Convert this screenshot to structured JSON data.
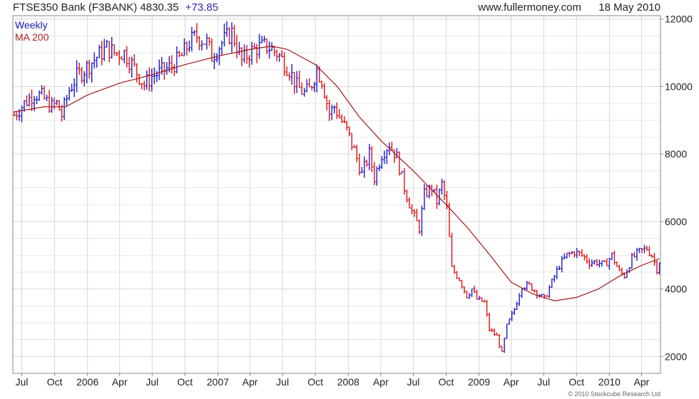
{
  "header": {
    "symbol_text": "FTSE350 Bank (F3BANK) 4830.35",
    "change": "+73.85",
    "site": "www.fullermoney.com",
    "date": "18 May 2010"
  },
  "legend": {
    "series1": "Weekly",
    "series2": "MA 200"
  },
  "copyright": "© 2010 Stockcube Research Ltd",
  "colors": {
    "up": "#1a1ad0",
    "down": "#e01010",
    "ma": "#a01818",
    "grid": "#d8d8d8",
    "frame": "#888888"
  },
  "chart_data": {
    "type": "line",
    "title": "FTSE350 Bank (F3BANK) 4830.35 +73.85",
    "xlabel": "",
    "ylabel": "",
    "ylim": [
      1500,
      12100
    ],
    "xlim": [
      "2005-06-06",
      "2010-05-24"
    ],
    "y_ticks": [
      2000,
      4000,
      6000,
      8000,
      10000,
      12000
    ],
    "x_ticks": [
      {
        "label": "Jul",
        "date": "2005-07-01"
      },
      {
        "label": "Oct",
        "date": "2005-10-01"
      },
      {
        "label": "2006",
        "date": "2006-01-01"
      },
      {
        "label": "Apr",
        "date": "2006-04-01"
      },
      {
        "label": "Jul",
        "date": "2006-07-01"
      },
      {
        "label": "Oct",
        "date": "2006-10-01"
      },
      {
        "label": "2007",
        "date": "2007-01-01"
      },
      {
        "label": "Apr",
        "date": "2007-04-01"
      },
      {
        "label": "Jul",
        "date": "2007-07-01"
      },
      {
        "label": "Oct",
        "date": "2007-10-01"
      },
      {
        "label": "2008",
        "date": "2008-01-01"
      },
      {
        "label": "Apr",
        "date": "2008-04-01"
      },
      {
        "label": "Jul",
        "date": "2008-07-01"
      },
      {
        "label": "Oct",
        "date": "2008-10-01"
      },
      {
        "label": "2009",
        "date": "2009-01-01"
      },
      {
        "label": "Apr",
        "date": "2009-04-01"
      },
      {
        "label": "Jul",
        "date": "2009-07-01"
      },
      {
        "label": "Oct",
        "date": "2009-10-01"
      },
      {
        "label": "2010",
        "date": "2010-01-01"
      },
      {
        "label": "Apr",
        "date": "2010-04-01"
      }
    ],
    "series": [
      {
        "name": "Weekly",
        "style": "bars, blue up / red down",
        "points": [
          [
            "2005-06-10",
            9150
          ],
          [
            "2005-07-08",
            9500
          ],
          [
            "2005-08-05",
            9800
          ],
          [
            "2005-08-26",
            9700
          ],
          [
            "2005-09-23",
            9400
          ],
          [
            "2005-10-07",
            9500
          ],
          [
            "2005-10-21",
            9150
          ],
          [
            "2005-11-11",
            9900
          ],
          [
            "2005-12-02",
            10300
          ],
          [
            "2005-12-23",
            10500
          ],
          [
            "2006-01-20",
            10800
          ],
          [
            "2006-02-24",
            11150
          ],
          [
            "2006-03-17",
            11000
          ],
          [
            "2006-04-14",
            11000
          ],
          [
            "2006-05-12",
            10550
          ],
          [
            "2006-06-09",
            10050
          ],
          [
            "2006-06-30",
            10300
          ],
          [
            "2006-07-28",
            10450
          ],
          [
            "2006-08-25",
            10600
          ],
          [
            "2006-09-22",
            10900
          ],
          [
            "2006-10-13",
            11300
          ],
          [
            "2006-11-03",
            11500
          ],
          [
            "2006-12-01",
            11300
          ],
          [
            "2006-12-15",
            10900
          ],
          [
            "2007-01-12",
            11300
          ],
          [
            "2007-02-09",
            11600
          ],
          [
            "2007-02-23",
            11200
          ],
          [
            "2007-03-09",
            10750
          ],
          [
            "2007-03-30",
            11000
          ],
          [
            "2007-04-20",
            11150
          ],
          [
            "2007-05-18",
            11200
          ],
          [
            "2007-06-15",
            11000
          ],
          [
            "2007-06-29",
            10800
          ],
          [
            "2007-07-20",
            10500
          ],
          [
            "2007-08-10",
            10000
          ],
          [
            "2007-08-31",
            9800
          ],
          [
            "2007-09-14",
            9900
          ],
          [
            "2007-10-05",
            10500
          ],
          [
            "2007-10-19",
            10200
          ],
          [
            "2007-11-09",
            9200
          ],
          [
            "2007-11-23",
            9400
          ],
          [
            "2007-12-07",
            9100
          ],
          [
            "2007-12-28",
            8700
          ],
          [
            "2008-01-18",
            8100
          ],
          [
            "2008-02-08",
            7400
          ],
          [
            "2008-02-29",
            8000
          ],
          [
            "2008-03-14",
            7300
          ],
          [
            "2008-04-04",
            8000
          ],
          [
            "2008-04-25",
            8300
          ],
          [
            "2008-05-16",
            7900
          ],
          [
            "2008-06-06",
            7000
          ],
          [
            "2008-06-27",
            6300
          ],
          [
            "2008-07-18",
            5800
          ],
          [
            "2008-08-01",
            6800
          ],
          [
            "2008-08-22",
            7000
          ],
          [
            "2008-09-05",
            6600
          ],
          [
            "2008-09-19",
            7100
          ],
          [
            "2008-10-03",
            6400
          ],
          [
            "2008-10-17",
            4600
          ],
          [
            "2008-11-07",
            4300
          ],
          [
            "2008-11-28",
            3800
          ],
          [
            "2008-12-12",
            4000
          ],
          [
            "2008-12-26",
            3700
          ],
          [
            "2009-01-16",
            3600
          ],
          [
            "2009-01-30",
            2800
          ],
          [
            "2009-02-20",
            2600
          ],
          [
            "2009-03-06",
            2100
          ],
          [
            "2009-03-20",
            2900
          ],
          [
            "2009-04-10",
            3400
          ],
          [
            "2009-05-01",
            4100
          ],
          [
            "2009-05-22",
            4100
          ],
          [
            "2009-06-12",
            3900
          ],
          [
            "2009-07-03",
            3700
          ],
          [
            "2009-07-24",
            4200
          ],
          [
            "2009-08-14",
            4700
          ],
          [
            "2009-09-04",
            5000
          ],
          [
            "2009-09-25",
            5100
          ],
          [
            "2009-10-16",
            5000
          ],
          [
            "2009-11-06",
            4800
          ],
          [
            "2009-11-27",
            4800
          ],
          [
            "2009-12-18",
            4700
          ],
          [
            "2010-01-08",
            5000
          ],
          [
            "2010-01-29",
            4500
          ],
          [
            "2010-02-12",
            4400
          ],
          [
            "2010-03-05",
            4900
          ],
          [
            "2010-03-26",
            5100
          ],
          [
            "2010-04-16",
            5200
          ],
          [
            "2010-04-30",
            5000
          ],
          [
            "2010-05-14",
            4600
          ],
          [
            "2010-05-21",
            4830
          ]
        ]
      },
      {
        "name": "MA 200",
        "style": "line",
        "points": [
          [
            "2005-06-10",
            9250
          ],
          [
            "2005-09-01",
            9400
          ],
          [
            "2005-11-01",
            9400
          ],
          [
            "2006-01-01",
            9750
          ],
          [
            "2006-04-01",
            10100
          ],
          [
            "2006-07-01",
            10350
          ],
          [
            "2006-10-01",
            10650
          ],
          [
            "2007-01-01",
            10900
          ],
          [
            "2007-04-01",
            11100
          ],
          [
            "2007-06-01",
            11200
          ],
          [
            "2007-07-15",
            11100
          ],
          [
            "2007-10-01",
            10650
          ],
          [
            "2007-12-01",
            10000
          ],
          [
            "2008-02-01",
            9100
          ],
          [
            "2008-04-01",
            8400
          ],
          [
            "2008-07-01",
            7500
          ],
          [
            "2008-10-01",
            6500
          ],
          [
            "2008-12-01",
            5800
          ],
          [
            "2009-02-01",
            5000
          ],
          [
            "2009-04-01",
            4200
          ],
          [
            "2009-06-01",
            3850
          ],
          [
            "2009-08-01",
            3650
          ],
          [
            "2009-10-01",
            3750
          ],
          [
            "2009-12-01",
            4000
          ],
          [
            "2010-02-01",
            4400
          ],
          [
            "2010-04-01",
            4700
          ],
          [
            "2010-05-21",
            4900
          ]
        ]
      }
    ]
  }
}
